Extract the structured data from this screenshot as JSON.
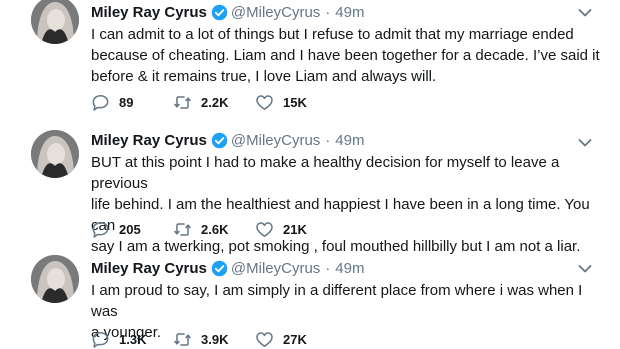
{
  "tweets": [
    {
      "name": "Miley Ray Cyrus",
      "handle": "@MileyCyrus",
      "separator": "·",
      "time": "49m",
      "text": "I can admit to a lot of things but I refuse to admit that my marriage ended\nbecause of cheating. Liam and I have been together for a decade. I’ve said it\nbefore & it remains true, I love Liam and always will.",
      "replies": "89",
      "retweets": "2.2K",
      "likes": "15K"
    },
    {
      "name": "Miley Ray Cyrus",
      "handle": "@MileyCyrus",
      "separator": "·",
      "time": "49m",
      "text": "BUT at this point I had to make a healthy decision for myself to leave a previous\nlife behind. I am the healthiest and happiest I have been in a long time.  You can\nsay I am a twerking, pot smoking , foul mouthed hillbilly but I am not a liar.",
      "replies": "205",
      "retweets": "2.6K",
      "likes": "21K"
    },
    {
      "name": "Miley Ray Cyrus",
      "handle": "@MileyCyrus",
      "separator": "·",
      "time": "49m",
      "text": "I am proud to say, I am simply in a different place from where i was when I was\na younger.",
      "replies": "1.3K",
      "retweets": "3.9K",
      "likes": "27K"
    }
  ],
  "icons": {
    "verified": "verified-badge-icon",
    "caret": "chevron-down-icon",
    "reply": "reply-icon",
    "retweet": "retweet-icon",
    "like": "heart-icon"
  },
  "colors": {
    "verified": "#1da1f2",
    "muted": "#657786",
    "text": "#14171a"
  }
}
